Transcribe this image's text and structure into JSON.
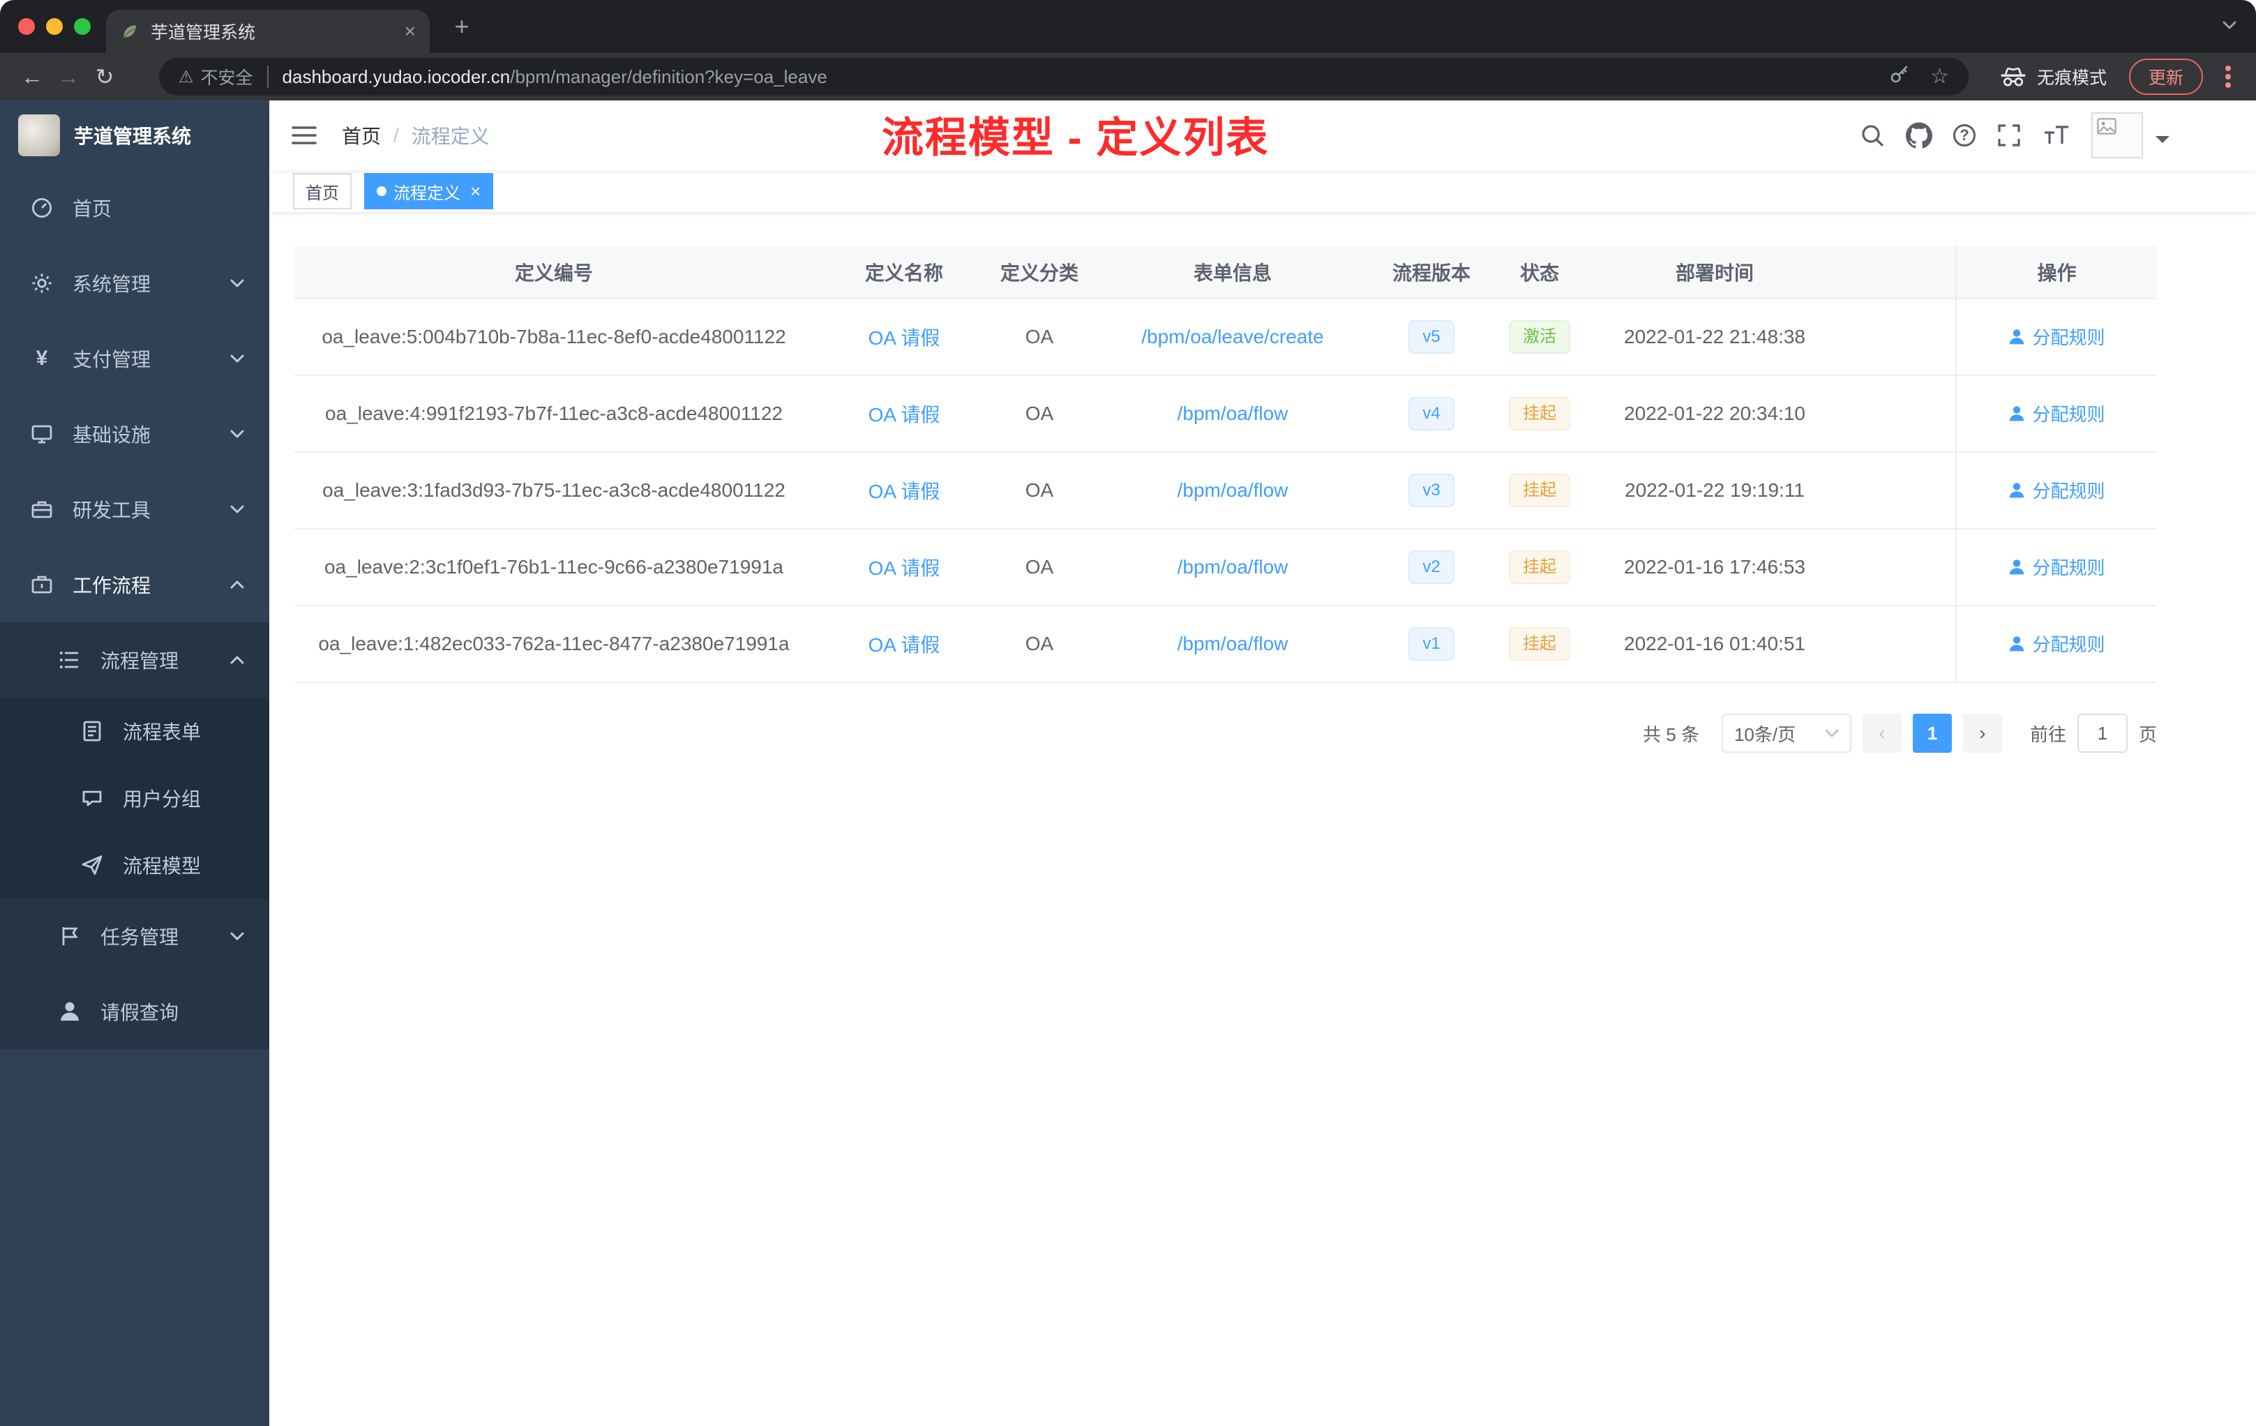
{
  "colors": {
    "accent": "#409eff",
    "success": "#67c23a",
    "warning": "#e6a23c",
    "annotation_red": "#fd2b2b",
    "sidebar_bg": "#304156"
  },
  "browser": {
    "tab_title": "芋道管理系统",
    "address": {
      "security_label": "不安全",
      "host": "dashboard.yudao.iocoder.cn",
      "path": "/bpm/manager/definition?key=oa_leave"
    },
    "incognito_label": "无痕模式",
    "update_label": "更新"
  },
  "icons": {
    "back": "←",
    "forward": "→",
    "reload": "↻",
    "warning": "⚠",
    "star": "☆",
    "new_tab": "+",
    "close": "×",
    "yen": "¥",
    "question": "?",
    "page_prev": "‹",
    "page_next": "›",
    "breadcrumb_sep": "/"
  },
  "sidebar": {
    "logo_title": "芋道管理系统",
    "items": [
      {
        "label": "首页"
      },
      {
        "label": "系统管理"
      },
      {
        "label": "支付管理"
      },
      {
        "label": "基础设施"
      },
      {
        "label": "研发工具"
      },
      {
        "label": "工作流程"
      },
      {
        "label": "流程管理"
      },
      {
        "label": "流程表单"
      },
      {
        "label": "用户分组"
      },
      {
        "label": "流程模型"
      },
      {
        "label": "任务管理"
      },
      {
        "label": "请假查询"
      }
    ]
  },
  "navbar": {
    "breadcrumb": [
      "首页",
      "流程定义"
    ],
    "annotation": "流程模型 - 定义列表"
  },
  "tags": [
    {
      "label": "首页"
    },
    {
      "label": "流程定义"
    }
  ],
  "table": {
    "columns": [
      "定义编号",
      "定义名称",
      "定义分类",
      "表单信息",
      "流程版本",
      "状态",
      "部署时间",
      "操作"
    ],
    "rows": [
      {
        "id": "oa_leave:5:004b710b-7b8a-11ec-8ef0-acde48001122",
        "name": "OA 请假",
        "category": "OA",
        "form": "/bpm/oa/leave/create",
        "version": "v5",
        "status": "激活",
        "time": "2022-01-22 21:48:38",
        "action": "分配规则"
      },
      {
        "id": "oa_leave:4:991f2193-7b7f-11ec-a3c8-acde48001122",
        "name": "OA 请假",
        "category": "OA",
        "form": "/bpm/oa/flow",
        "version": "v4",
        "status": "挂起",
        "time": "2022-01-22 20:34:10",
        "action": "分配规则"
      },
      {
        "id": "oa_leave:3:1fad3d93-7b75-11ec-a3c8-acde48001122",
        "name": "OA 请假",
        "category": "OA",
        "form": "/bpm/oa/flow",
        "version": "v3",
        "status": "挂起",
        "time": "2022-01-22 19:19:11",
        "action": "分配规则"
      },
      {
        "id": "oa_leave:2:3c1f0ef1-76b1-11ec-9c66-a2380e71991a",
        "name": "OA 请假",
        "category": "OA",
        "form": "/bpm/oa/flow",
        "version": "v2",
        "status": "挂起",
        "time": "2022-01-16 17:46:53",
        "action": "分配规则"
      },
      {
        "id": "oa_leave:1:482ec033-762a-11ec-8477-a2380e71991a",
        "name": "OA 请假",
        "category": "OA",
        "form": "/bpm/oa/flow",
        "version": "v1",
        "status": "挂起",
        "time": "2022-01-16 01:40:51",
        "action": "分配规则"
      }
    ]
  },
  "pagination": {
    "total": "共 5 条",
    "page_size": "10条/页",
    "current_page": "1",
    "goto_label": "前往",
    "goto_value": "1",
    "unit_label": "页"
  }
}
